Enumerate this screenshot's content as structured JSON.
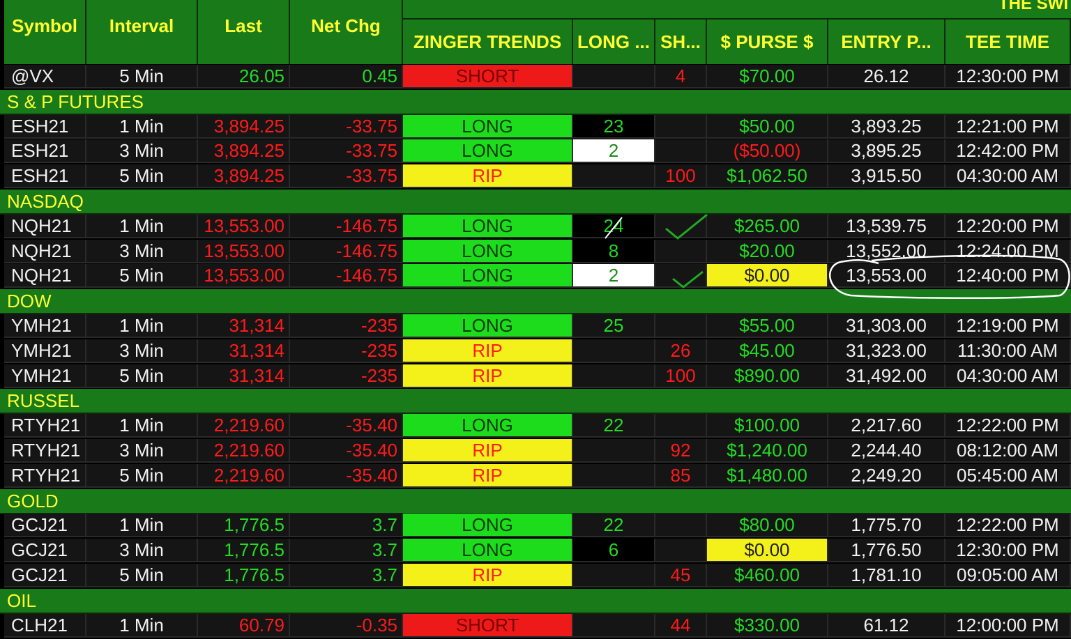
{
  "group_title": "THE SWI",
  "headers": {
    "symbol": "Symbol",
    "interval": "Interval",
    "last": "Last",
    "net_chg": "Net Chg",
    "zinger": "ZINGER TRENDS",
    "long": "LONG ...",
    "short": "SH...",
    "purse": "$ PURSE $",
    "entry": "ENTRY P...",
    "tee": "TEE TIME"
  },
  "colors": {
    "header_bg": "#187a18",
    "header_text": "#ffff33",
    "long_bg": "#1cdc1c",
    "short_bg": "#ee1a1a",
    "rip_bg": "#f4f01a",
    "up_text": "#22dd22",
    "down_text": "#ff1a1a"
  },
  "rows": [
    {
      "type": "data",
      "symbol": "@VX",
      "interval": "5 Min",
      "last": "26.05",
      "net_chg": "0.45",
      "dir": "up",
      "trend": "SHORT",
      "long": "",
      "long_style": "",
      "short": "4",
      "purse": "$70.00",
      "purse_style": "green",
      "entry": "26.12",
      "tee": "12:30:00 PM"
    },
    {
      "type": "section",
      "label": "S & P FUTURES"
    },
    {
      "type": "data",
      "symbol": "ESH21",
      "interval": "1 Min",
      "last": "3,894.25",
      "net_chg": "-33.75",
      "dir": "down",
      "trend": "LONG",
      "long": "23",
      "long_style": "black",
      "short": "",
      "purse": "$50.00",
      "purse_style": "green",
      "entry": "3,893.25",
      "tee": "12:21:00 PM"
    },
    {
      "type": "data",
      "symbol": "ESH21",
      "interval": "3 Min",
      "last": "3,894.25",
      "net_chg": "-33.75",
      "dir": "down",
      "trend": "LONG",
      "long": "2",
      "long_style": "white",
      "short": "",
      "purse": "($50.00)",
      "purse_style": "red",
      "entry": "3,895.25",
      "tee": "12:42:00 PM"
    },
    {
      "type": "data",
      "symbol": "ESH21",
      "interval": "5 Min",
      "last": "3,894.25",
      "net_chg": "-33.75",
      "dir": "down",
      "trend": "RIP",
      "long": "",
      "long_style": "",
      "short": "100",
      "purse": "$1,062.50",
      "purse_style": "green",
      "entry": "3,915.50",
      "tee": "04:30:00 AM"
    },
    {
      "type": "section",
      "label": "NASDAQ"
    },
    {
      "type": "data",
      "symbol": "NQH21",
      "interval": "1 Min",
      "last": "13,553.00",
      "net_chg": "-146.75",
      "dir": "down",
      "trend": "LONG",
      "long": "24",
      "long_style": "black",
      "short": "",
      "purse": "$265.00",
      "purse_style": "green",
      "entry": "13,539.75",
      "tee": "12:20:00 PM"
    },
    {
      "type": "data",
      "symbol": "NQH21",
      "interval": "3 Min",
      "last": "13,553.00",
      "net_chg": "-146.75",
      "dir": "down",
      "trend": "LONG",
      "long": "8",
      "long_style": "black",
      "short": "",
      "purse": "$20.00",
      "purse_style": "green",
      "entry": "13,552.00",
      "tee": "12:24:00 PM"
    },
    {
      "type": "data",
      "symbol": "NQH21",
      "interval": "5 Min",
      "last": "13,553.00",
      "net_chg": "-146.75",
      "dir": "down",
      "trend": "LONG",
      "long": "2",
      "long_style": "white",
      "short": "",
      "purse": "$0.00",
      "purse_style": "yellow",
      "entry": "13,553.00",
      "tee": "12:40:00 PM"
    },
    {
      "type": "section",
      "label": "DOW"
    },
    {
      "type": "data",
      "symbol": "YMH21",
      "interval": "1 Min",
      "last": "31,314",
      "net_chg": "-235",
      "dir": "down",
      "trend": "LONG",
      "long": "25",
      "long_style": "",
      "short": "",
      "purse": "$55.00",
      "purse_style": "green",
      "entry": "31,303.00",
      "tee": "12:19:00 PM"
    },
    {
      "type": "data",
      "symbol": "YMH21",
      "interval": "3 Min",
      "last": "31,314",
      "net_chg": "-235",
      "dir": "down",
      "trend": "RIP",
      "long": "",
      "long_style": "",
      "short": "26",
      "purse": "$45.00",
      "purse_style": "green",
      "entry": "31,323.00",
      "tee": "11:30:00 AM"
    },
    {
      "type": "data",
      "symbol": "YMH21",
      "interval": "5 Min",
      "last": "31,314",
      "net_chg": "-235",
      "dir": "down",
      "trend": "RIP",
      "long": "",
      "long_style": "",
      "short": "100",
      "purse": "$890.00",
      "purse_style": "green",
      "entry": "31,492.00",
      "tee": "04:30:00 AM"
    },
    {
      "type": "section",
      "label": "RUSSEL"
    },
    {
      "type": "data",
      "symbol": "RTYH21",
      "interval": "1 Min",
      "last": "2,219.60",
      "net_chg": "-35.40",
      "dir": "down",
      "trend": "LONG",
      "long": "22",
      "long_style": "",
      "short": "",
      "purse": "$100.00",
      "purse_style": "green",
      "entry": "2,217.60",
      "tee": "12:22:00 PM"
    },
    {
      "type": "data",
      "symbol": "RTYH21",
      "interval": "3 Min",
      "last": "2,219.60",
      "net_chg": "-35.40",
      "dir": "down",
      "trend": "RIP",
      "long": "",
      "long_style": "",
      "short": "92",
      "purse": "$1,240.00",
      "purse_style": "green",
      "entry": "2,244.40",
      "tee": "08:12:00 AM"
    },
    {
      "type": "data",
      "symbol": "RTYH21",
      "interval": "5 Min",
      "last": "2,219.60",
      "net_chg": "-35.40",
      "dir": "down",
      "trend": "RIP",
      "long": "",
      "long_style": "",
      "short": "85",
      "purse": "$1,480.00",
      "purse_style": "green",
      "entry": "2,249.20",
      "tee": "05:45:00 AM"
    },
    {
      "type": "section",
      "label": "GOLD"
    },
    {
      "type": "data",
      "symbol": "GCJ21",
      "interval": "1 Min",
      "last": "1,776.5",
      "net_chg": "3.7",
      "dir": "up",
      "trend": "LONG",
      "long": "22",
      "long_style": "",
      "short": "",
      "purse": "$80.00",
      "purse_style": "green",
      "entry": "1,775.70",
      "tee": "12:22:00 PM"
    },
    {
      "type": "data",
      "symbol": "GCJ21",
      "interval": "3 Min",
      "last": "1,776.5",
      "net_chg": "3.7",
      "dir": "up",
      "trend": "LONG",
      "long": "6",
      "long_style": "black",
      "short": "",
      "purse": "$0.00",
      "purse_style": "yellow",
      "entry": "1,776.50",
      "tee": "12:30:00 PM"
    },
    {
      "type": "data",
      "symbol": "GCJ21",
      "interval": "5 Min",
      "last": "1,776.5",
      "net_chg": "3.7",
      "dir": "up",
      "trend": "RIP",
      "long": "",
      "long_style": "",
      "short": "45",
      "purse": "$460.00",
      "purse_style": "green",
      "entry": "1,781.10",
      "tee": "09:05:00 AM"
    },
    {
      "type": "section",
      "label": "OIL"
    },
    {
      "type": "data",
      "symbol": "CLH21",
      "interval": "1 Min",
      "last": "60.79",
      "net_chg": "-0.35",
      "dir": "down",
      "trend": "SHORT",
      "long": "",
      "long_style": "",
      "short": "44",
      "purse": "$330.00",
      "purse_style": "green",
      "entry": "61.12",
      "tee": "12:00:00 PM"
    }
  ]
}
